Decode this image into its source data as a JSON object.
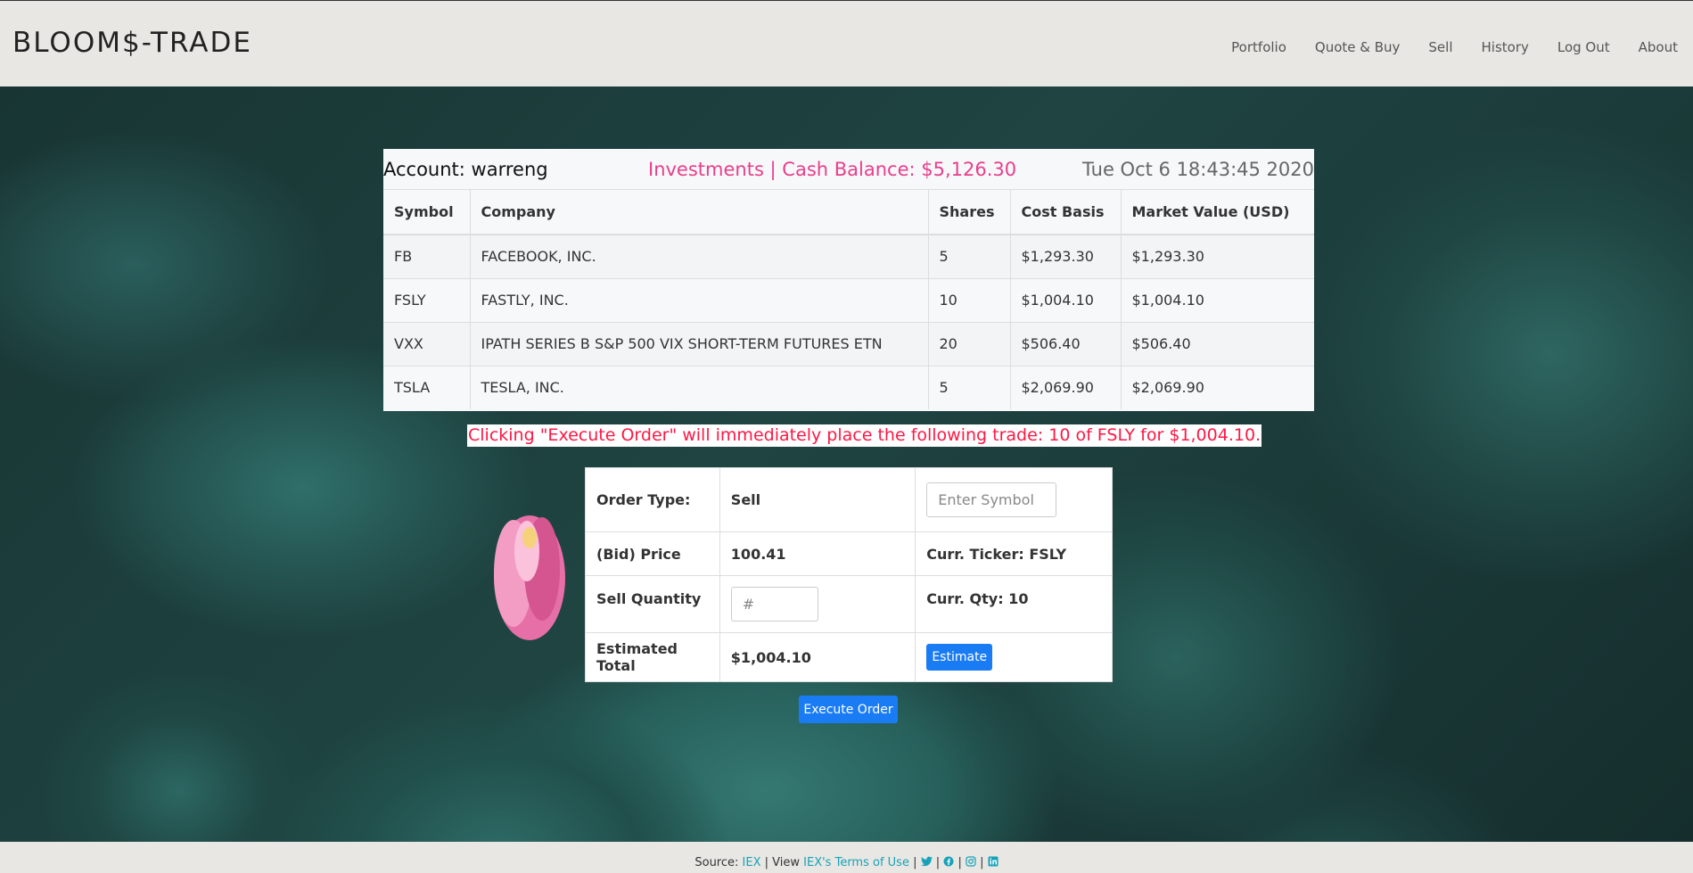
{
  "header": {
    "brand": "BLOOM$-TRADE",
    "nav": [
      "Portfolio",
      "Quote & Buy",
      "Sell",
      "History",
      "Log Out",
      "About"
    ]
  },
  "portfolio": {
    "account_label": "Account: warreng",
    "cash_label": "Investments | Cash Balance: $5,126.30",
    "datetime": "Tue Oct 6 18:43:45 2020",
    "columns": [
      "Symbol",
      "Company",
      "Shares",
      "Cost Basis",
      "Market Value (USD)"
    ],
    "rows": [
      [
        "FB",
        "FACEBOOK, INC.",
        "5",
        "$1,293.30",
        "$1,293.30"
      ],
      [
        "FSLY",
        "FASTLY, INC.",
        "10",
        "$1,004.10",
        "$1,004.10"
      ],
      [
        "VXX",
        "IPATH SERIES B S&P 500 VIX SHORT-TERM FUTURES ETN",
        "20",
        "$506.40",
        "$506.40"
      ],
      [
        "TSLA",
        "TESLA, INC.",
        "5",
        "$2,069.90",
        "$2,069.90"
      ]
    ]
  },
  "warning": "Clicking \"Execute Order\" will immediately place the following trade: 10 of FSLY for $1,004.10.",
  "order": {
    "order_type_label": "Order Type:",
    "order_type_value": "Sell",
    "symbol_placeholder": "Enter Symbol",
    "bid_label": "(Bid) Price",
    "bid_value": "100.41",
    "ticker_label": "Curr. Ticker: FSLY",
    "qty_label": "Sell Quantity",
    "qty_placeholder": "#",
    "curr_qty_label": "Curr. Qty: 10",
    "total_label": "Estimated Total",
    "total_value": "$1,004.10",
    "estimate_button": "Estimate",
    "execute_button": "Execute Order"
  },
  "footer": {
    "source_prefix": "Source:",
    "source_link": "IEX",
    "view_prefix": "| View",
    "terms_link": "IEX's Terms of Use",
    "separator": "|"
  },
  "colors": {
    "accent_pink": "#e83e8c",
    "warning_red": "#ff1744",
    "primary_blue": "#1a7cf5",
    "link_teal": "#17a2b8"
  }
}
